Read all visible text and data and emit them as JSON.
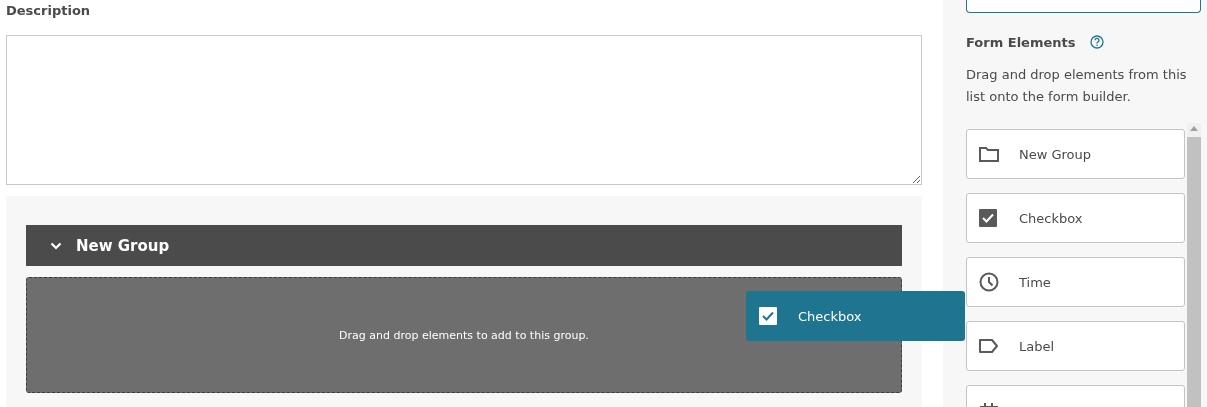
{
  "description": {
    "label": "Description"
  },
  "group": {
    "title": "New Group",
    "expanded": true,
    "drop_hint": "Drag and drop elements to add to this group."
  },
  "palette": {
    "title": "Form Elements",
    "help": "Drag and drop elements from this list onto the form builder.",
    "items": [
      {
        "kind": "group",
        "label": "New Group"
      },
      {
        "kind": "checkbox",
        "label": "Checkbox"
      },
      {
        "kind": "time",
        "label": "Time"
      },
      {
        "kind": "label",
        "label": "Label"
      },
      {
        "kind": "number"
      }
    ]
  },
  "drag_preview": {
    "kind": "checkbox",
    "label": "Checkbox"
  }
}
